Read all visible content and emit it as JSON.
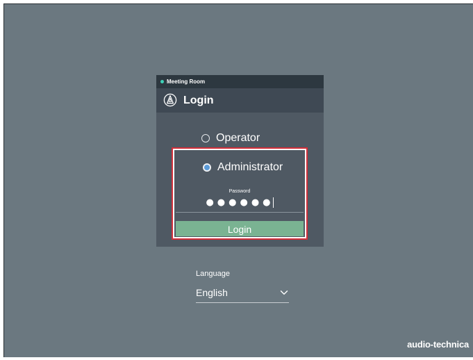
{
  "room": {
    "name": "Meeting Room",
    "status_color": "#3fd1b8"
  },
  "header": {
    "logo_icon": "audio-technica-triangle-logo-icon",
    "title": "Login"
  },
  "roles": {
    "operator_label": "Operator",
    "administrator_label": "Administrator",
    "selected": "Administrator"
  },
  "password": {
    "label": "Password",
    "masked_value": "●●●●●●"
  },
  "login_button": {
    "label": "Login",
    "color": "#7ab392"
  },
  "language": {
    "label": "Language",
    "selected": "English",
    "dropdown_icon": "chevron-down-icon"
  },
  "brand": {
    "logo_text": "audio-technica"
  },
  "colors": {
    "background": "#6b7880",
    "panel": "#4f5963",
    "highlight_border": "#d32f3a",
    "radio_selected": "#5b9bd8"
  }
}
